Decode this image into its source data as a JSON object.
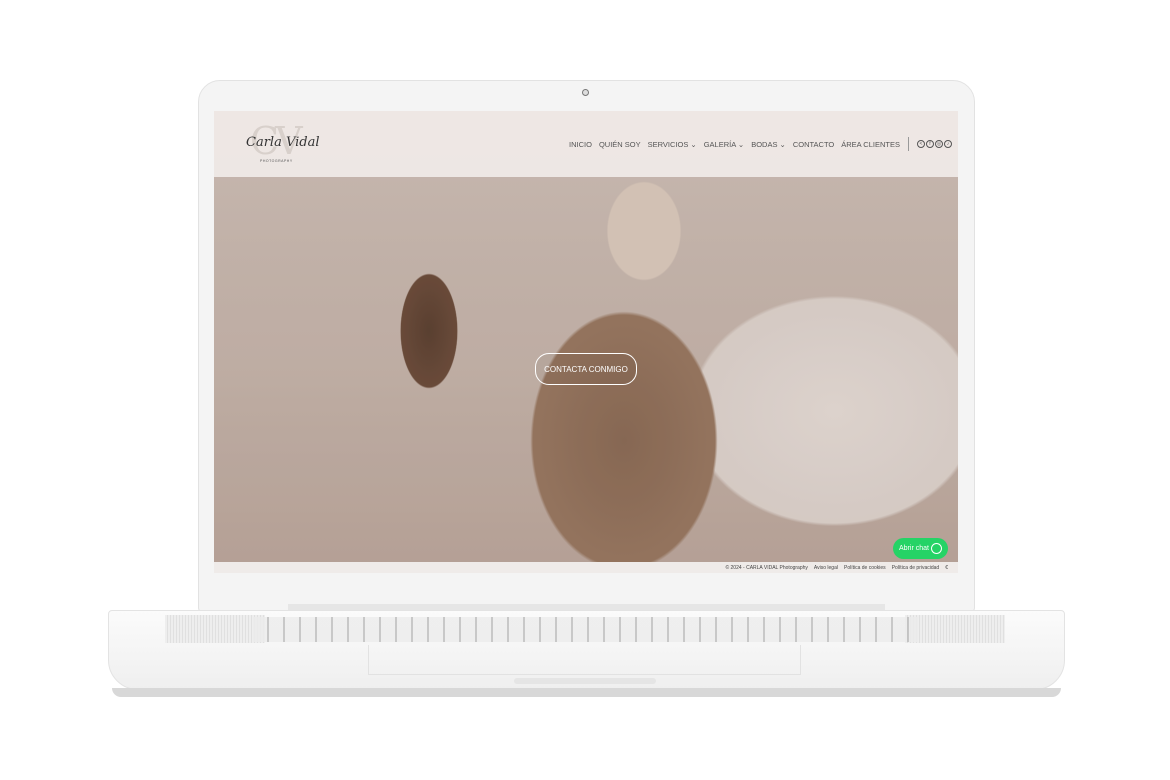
{
  "site": {
    "logo": {
      "monogram": "CV",
      "signature": "Carla Vidal",
      "tagline": "PHOTOGRAPHY"
    },
    "nav": [
      "INICIO",
      "QUIÉN SOY",
      "SERVICIOS ⌄",
      "GALERÍA ⌄",
      "BODAS ⌄",
      "CONTACTO",
      "ÁREA CLIENTES"
    ],
    "social_icons": [
      "share-icon",
      "facebook-icon",
      "instagram-icon",
      "tiktok-icon"
    ],
    "cta": "CONTACTA CONMIGO",
    "chat": "Abrir chat",
    "footer": [
      "© 2024 - CARLA VIDAL Photography",
      "Aviso legal",
      "Política de cookies",
      "Política de privacidad"
    ],
    "colors": {
      "chat": "#25d366"
    }
  }
}
